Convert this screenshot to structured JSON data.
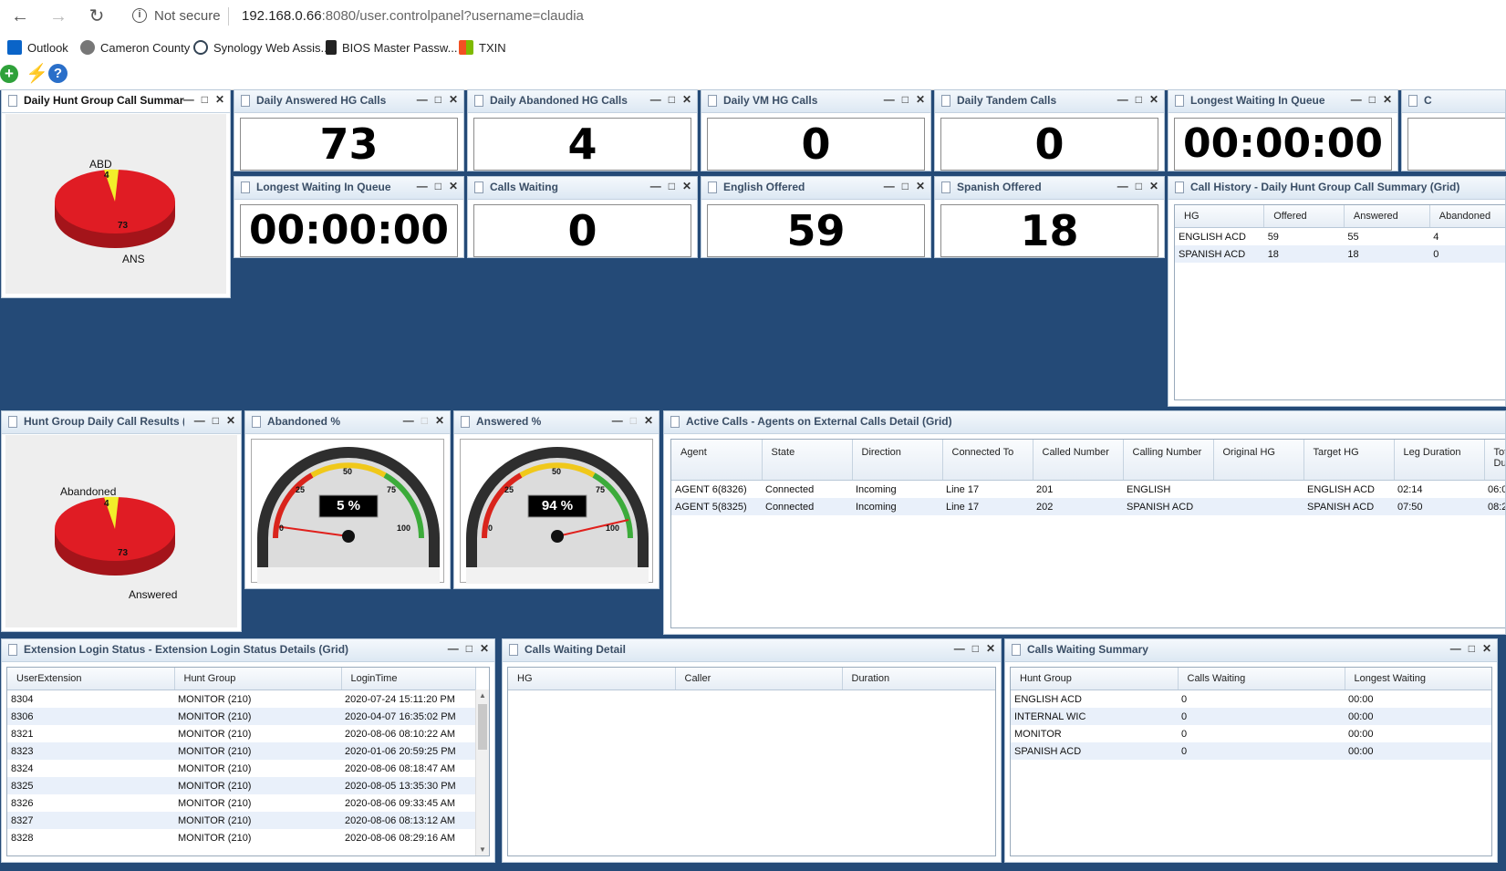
{
  "browser": {
    "security": "Not secure",
    "url_host": "192.168.0.66",
    "url_rest": ":8080/user.controlpanel?username=claudia",
    "bookmarks": [
      {
        "label": "Outlook",
        "icon": "outlook-icon"
      },
      {
        "label": "Cameron County",
        "icon": "globe-icon"
      },
      {
        "label": "Synology Web Assis...",
        "icon": "synology-icon"
      },
      {
        "label": "BIOS Master Passw...",
        "icon": "lock-icon"
      },
      {
        "label": "TXIN",
        "icon": "windows-icon"
      }
    ]
  },
  "panels": {
    "daily_summary": {
      "title": "Daily Hunt Group Call Summary",
      "label_abd": "ABD",
      "label_ans": "ANS",
      "value_abd": "4",
      "value_ans": "73"
    },
    "answered_hg": {
      "title": "Daily Answered HG Calls",
      "value": "73"
    },
    "abandoned_hg": {
      "title": "Daily Abandoned HG Calls",
      "value": "4"
    },
    "vm_hg": {
      "title": "Daily VM HG Calls",
      "value": "0"
    },
    "tandem": {
      "title": "Daily Tandem Calls",
      "value": "0"
    },
    "longest_wait_1": {
      "title": "Longest Waiting In Queue",
      "value": "00:00:00"
    },
    "cut_panel": {
      "title": "C"
    },
    "longest_wait_2": {
      "title": "Longest Waiting In Queue",
      "value": "00:00:00"
    },
    "calls_waiting": {
      "title": "Calls Waiting",
      "value": "0"
    },
    "english_offered": {
      "title": "English Offered",
      "value": "59"
    },
    "spanish_offered": {
      "title": "Spanish Offered",
      "value": "18"
    },
    "call_history": {
      "title": "Call History - Daily Hunt Group Call Summary (Grid)",
      "columns": [
        "HG",
        "Offered",
        "Answered",
        "Abandoned"
      ],
      "rows": [
        [
          "ENGLISH ACD",
          "59",
          "55",
          "4"
        ],
        [
          "SPANISH ACD",
          "18",
          "18",
          "0"
        ]
      ]
    },
    "hg_results": {
      "title": "Hunt Group Daily Call Results (Pi",
      "label_abandoned": "Abandoned",
      "label_answered": "Answered",
      "value_abandoned": "4",
      "value_answered": "73"
    },
    "abandoned_pct": {
      "title": "Abandoned %",
      "value": "5 %",
      "ticks": [
        "0",
        "25",
        "50",
        "75",
        "100"
      ]
    },
    "answered_pct": {
      "title": "Answered %",
      "value": "94 %",
      "ticks": [
        "0",
        "25",
        "50",
        "75",
        "100"
      ]
    },
    "active_calls": {
      "title": "Active Calls - Agents on External Calls Detail (Grid)",
      "columns": [
        "Agent",
        "State",
        "Direction",
        "Connected To",
        "Called Number",
        "Calling Number",
        "Original HG",
        "Target HG",
        "Leg Duration",
        "Total Duration"
      ],
      "rows": [
        [
          "AGENT 6(8326)",
          "Connected",
          "Incoming",
          "Line 17",
          "201",
          "ENGLISH",
          "",
          "ENGLISH ACD",
          "02:14",
          "06:0"
        ],
        [
          "AGENT 5(8325)",
          "Connected",
          "Incoming",
          "Line 17",
          "202",
          "SPANISH ACD",
          "",
          "SPANISH ACD",
          "07:50",
          "08:2"
        ]
      ]
    },
    "ext_login": {
      "title": "Extension Login Status - Extension Login Status Details (Grid)",
      "columns": [
        "UserExtension",
        "Hunt Group",
        "LoginTime"
      ],
      "rows": [
        [
          "8304",
          "MONITOR (210)",
          "2020-07-24 15:11:20 PM"
        ],
        [
          "8306",
          "MONITOR (210)",
          "2020-04-07 16:35:02 PM"
        ],
        [
          "8321",
          "MONITOR (210)",
          "2020-08-06 08:10:22 AM"
        ],
        [
          "8323",
          "MONITOR (210)",
          "2020-01-06 20:59:25 PM"
        ],
        [
          "8324",
          "MONITOR (210)",
          "2020-08-06 08:18:47 AM"
        ],
        [
          "8325",
          "MONITOR (210)",
          "2020-08-05 13:35:30 PM"
        ],
        [
          "8326",
          "MONITOR (210)",
          "2020-08-06 09:33:45 AM"
        ],
        [
          "8327",
          "MONITOR (210)",
          "2020-08-06 08:13:12 AM"
        ],
        [
          "8328",
          "MONITOR (210)",
          "2020-08-06 08:29:16 AM"
        ]
      ]
    },
    "cw_detail": {
      "title": "Calls Waiting Detail",
      "columns": [
        "HG",
        "Caller",
        "Duration"
      ]
    },
    "cw_summary": {
      "title": "Calls Waiting Summary",
      "columns": [
        "Hunt Group",
        "Calls Waiting",
        "Longest Waiting"
      ],
      "rows": [
        [
          "ENGLISH ACD",
          "0",
          "00:00"
        ],
        [
          "INTERNAL WIC",
          "0",
          "00:00"
        ],
        [
          "MONITOR",
          "0",
          "00:00"
        ],
        [
          "SPANISH ACD",
          "0",
          "00:00"
        ]
      ]
    }
  },
  "colors": {
    "dashboard_bg": "#244a77",
    "pie_red": "#e01c24",
    "pie_yellow": "#f2ee2a",
    "needle": "#e0201c"
  }
}
